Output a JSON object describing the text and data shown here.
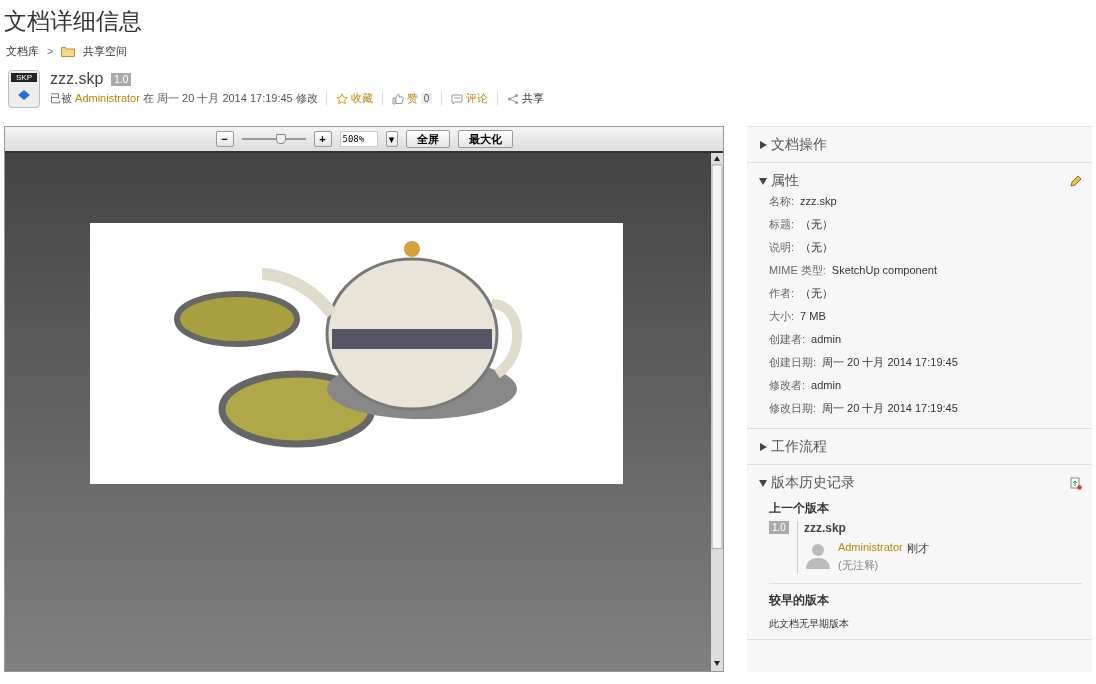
{
  "page_title": "文档详细信息",
  "breadcrumb": [
    {
      "label": "文档库",
      "kind": "text"
    },
    {
      "label": ">",
      "kind": "separator"
    },
    {
      "label": "共享空间",
      "kind": "folder"
    }
  ],
  "document": {
    "name": "zzz.skp",
    "version": "1.0",
    "file_type": "SKP",
    "modified_prefix": "已被",
    "modified_by": "Administrator",
    "modified_suffix": "在 周一 20 十月 2014 17:19:45 修改",
    "actions": [
      {
        "kind": "favorite",
        "label": "收藏"
      },
      {
        "kind": "like",
        "label": "赞",
        "count": "0"
      },
      {
        "kind": "comment",
        "label": "评论"
      },
      {
        "kind": "share",
        "label": "共享"
      }
    ]
  },
  "viewer_toolbar": {
    "minus": "−",
    "plus": "+",
    "level": 0.6,
    "zoom_value": "508%",
    "dropdown": "▾",
    "buttons": [
      "全屏",
      "最大化"
    ]
  },
  "sidebar": [
    {
      "title": "文档操作",
      "expanded": false,
      "kind": "plain"
    },
    {
      "title": "属性",
      "expanded": true,
      "kind": "properties",
      "properties": [
        {
          "label": "名称:",
          "value": "zzz.skp"
        },
        {
          "label": "标题:",
          "value": "（无）"
        },
        {
          "label": "说明:",
          "value": "（无）"
        },
        {
          "label": "MIME 类型:",
          "value": "SketchUp component"
        },
        {
          "label": "作者:",
          "value": "（无）"
        },
        {
          "label": "大小:",
          "value": "7 MB"
        },
        {
          "label": "创建者:",
          "value": "admin"
        },
        {
          "label": "创建日期:",
          "value": "周一 20 十月 2014 17:19:45"
        },
        {
          "label": "修改者:",
          "value": "admin"
        },
        {
          "label": "修改日期:",
          "value": "周一 20 十月 2014 17:19:45"
        }
      ]
    },
    {
      "title": "工作流程",
      "expanded": false,
      "kind": "plain"
    },
    {
      "title": "版本历史记录",
      "expanded": true,
      "kind": "versions",
      "latest_heading": "上一个版本",
      "latest": {
        "version": "1.0",
        "name": "zzz.skp",
        "user": "Administrator",
        "time": "刚才",
        "comment": "(无注释)"
      },
      "older_heading": "较早的版本",
      "older_text": "此文档无早期版本"
    }
  ]
}
